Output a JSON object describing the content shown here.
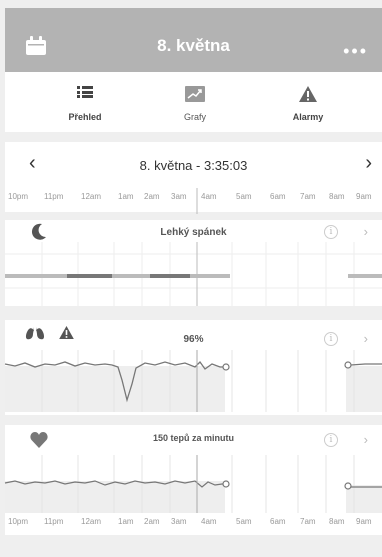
{
  "header": {
    "title": "8. května",
    "more": "•••",
    "calendar_icon": "calendar-icon"
  },
  "tabs": [
    {
      "label": "Přehled",
      "icon": "list-icon",
      "active": true
    },
    {
      "label": "Grafy",
      "icon": "chart-icon",
      "active": false
    },
    {
      "label": "Alarmy",
      "icon": "warning-icon",
      "active": false
    }
  ],
  "datebar": {
    "prev": "‹",
    "next": "›",
    "date": "8. května - 3:35:03"
  },
  "hours": [
    "10pm",
    "11pm",
    "12am",
    "1am",
    "2am",
    "3am",
    "4am",
    "5am",
    "6am",
    "7am",
    "8am",
    "9am"
  ],
  "sleep": {
    "title": "Lehký spánek",
    "icon": "moon-icon",
    "info": "i",
    "chevron": "›"
  },
  "oxygen": {
    "title": "96%",
    "icon": "lungs-icon",
    "warning_icon": "warning-icon",
    "info": "i",
    "chevron": "›"
  },
  "heart": {
    "title": "150 tepů za minutu",
    "icon": "heart-icon",
    "info": "i",
    "chevron": "›"
  }
}
